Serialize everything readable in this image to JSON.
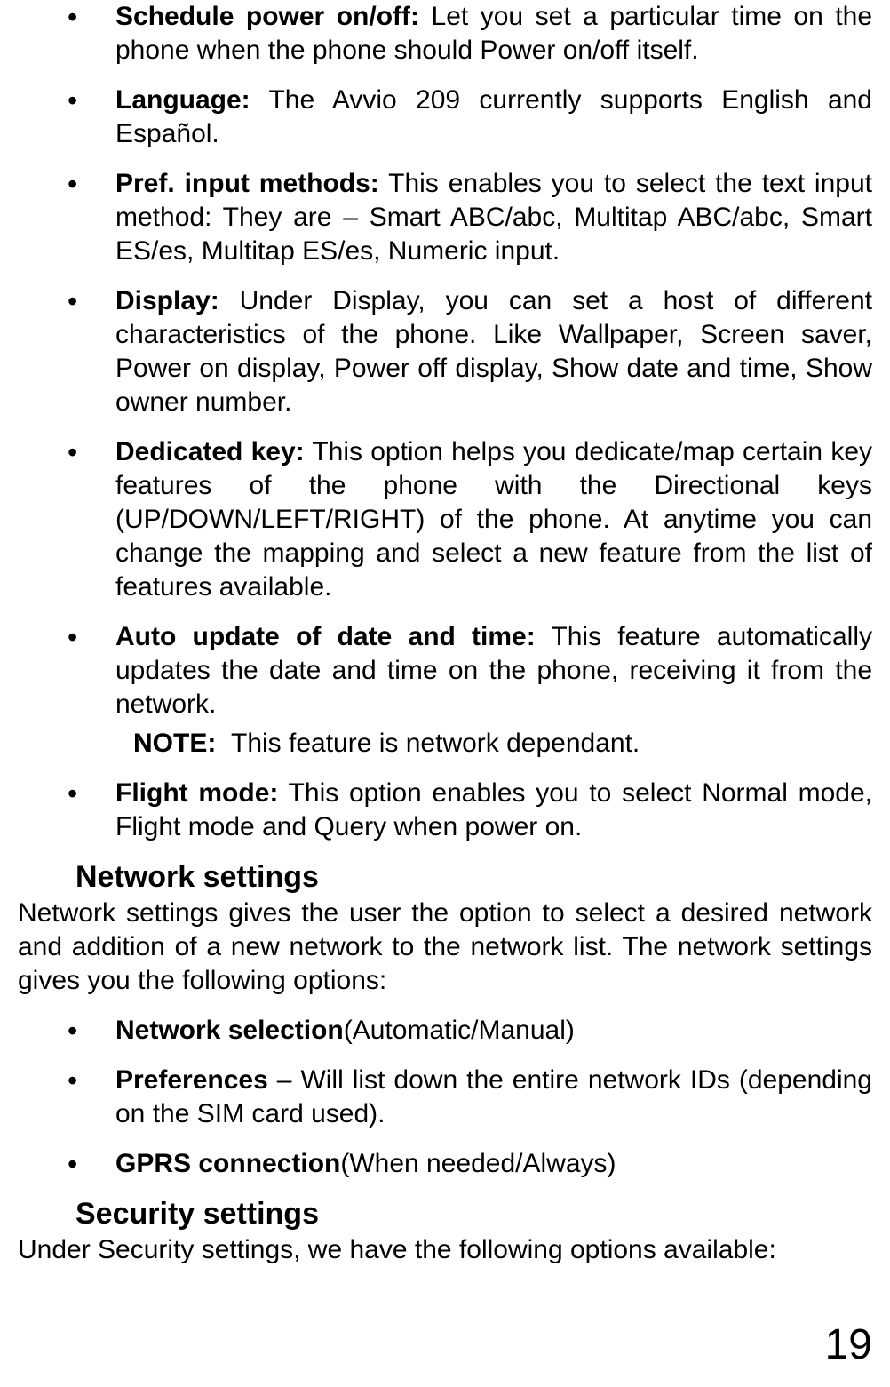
{
  "bullets1": [
    {
      "label": "Schedule power on/off:",
      "text": " Let you set a particular time on the phone when the phone should Power on/off itself."
    },
    {
      "label": "Language:",
      "text": " The Avvio 209 currently supports English and Español."
    },
    {
      "label": "Pref. input methods:",
      "text": " This enables you to select the text input method: They are – Smart ABC/abc, Multitap ABC/abc, Smart ES/es, Multitap ES/es, Numeric input."
    },
    {
      "label": "Display:",
      "text": " Under Display, you can set a host of different characteristics of the phone. Like Wallpaper, Screen saver, Power on display, Power off display, Show date and time, Show owner number."
    },
    {
      "label": "Dedicated key:",
      "text": " This option helps you dedicate/map certain key features of the phone with the Directional keys (UP/DOWN/LEFT/RIGHT) of the phone. At anytime you can change the mapping and select a new feature from the list of features available."
    },
    {
      "label": "Auto update of date and time:",
      "text": " This feature automatically updates the date and time on the phone, receiving it from the network."
    }
  ],
  "note": {
    "label": "NOTE:",
    "text": "This feature is network dependant."
  },
  "bullets1b": [
    {
      "label": "Flight mode:",
      "text": " This option enables you to select Normal mode, Flight mode and Query when power on."
    }
  ],
  "section_network": {
    "heading": "Network settings",
    "intro": "Network settings gives the user the option to select a desired network and addition of a new network to the network list. The network settings gives you the following options:"
  },
  "bullets2": [
    {
      "label": "Network selection",
      "text": "(Automatic/Manual)"
    },
    {
      "label": "Preferences",
      "text": " – Will list down the entire network IDs (depending on the SIM card used)."
    },
    {
      "label": "GPRS connection",
      "text": "(When needed/Always)"
    }
  ],
  "section_security": {
    "heading": "Security settings",
    "intro": "Under Security settings, we have the following options available:"
  },
  "page_number": "19"
}
